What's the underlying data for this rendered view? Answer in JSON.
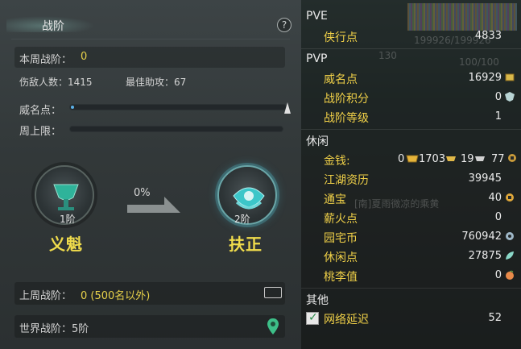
{
  "left": {
    "title": "战阶",
    "help": "?",
    "week_rank_label": "本周战阶：",
    "week_rank_value": "0",
    "enemies_label": "伤敌人数：1415",
    "assist_label": "最佳助攻：67",
    "fame_label": "威名点：",
    "week_cap_label": "周上限：",
    "fame_progress": 0.01,
    "progress_pct": "0%",
    "rank_current_num": "1阶",
    "rank_current_name": "义魁",
    "rank_next_num": "2阶",
    "rank_next_name": "扶正",
    "last_week_label": "上周战阶：",
    "last_week_value": "0 (500名以外)",
    "world_rank_label": "世界战阶：5阶"
  },
  "right": {
    "pve_header": "PVE",
    "xiaxing_label": "侠行点",
    "xiaxing_value": "4833",
    "pvp_header": "PVP",
    "weiming_label": "威名点",
    "weiming_value": "16929",
    "zhanjie_score_label": "战阶积分",
    "zhanjie_score_value": "0",
    "zhanjie_level_label": "战阶等级",
    "zhanjie_level_value": "1",
    "leisure_header": "休闲",
    "money_label": "金钱:",
    "money_gold": "0",
    "money_silver_big": "1703",
    "money_silver": "19",
    "money_copper": "77",
    "jianghu_label": "江湖资历",
    "jianghu_value": "39945",
    "tongbao_label": "通宝",
    "tongbao_value": "40",
    "xinhuo_label": "薪火点",
    "xinhuo_value": "0",
    "yuanzhai_label": "园宅币",
    "yuanzhai_value": "760942",
    "xiuxian_label": "休闲点",
    "xiuxian_value": "27875",
    "taoli_label": "桃李值",
    "taoli_value": "0",
    "other_header": "其他",
    "latency_label": "网络延迟",
    "latency_value": "52",
    "bg_text_1": "199926/199926",
    "bg_text_2": "130",
    "bg_text_3": "100/100",
    "bg_text_4": "[南]夏雨微凉的乘黄"
  },
  "colors": {
    "accent_yellow": "#f0d048",
    "progress_blue": "#5bb0e8",
    "check_green": "#2a8c4a"
  },
  "icons": [
    "help-icon",
    "chest-icon",
    "map-pin-icon",
    "ingot-icon",
    "coin-icon",
    "checkbox-icon"
  ]
}
